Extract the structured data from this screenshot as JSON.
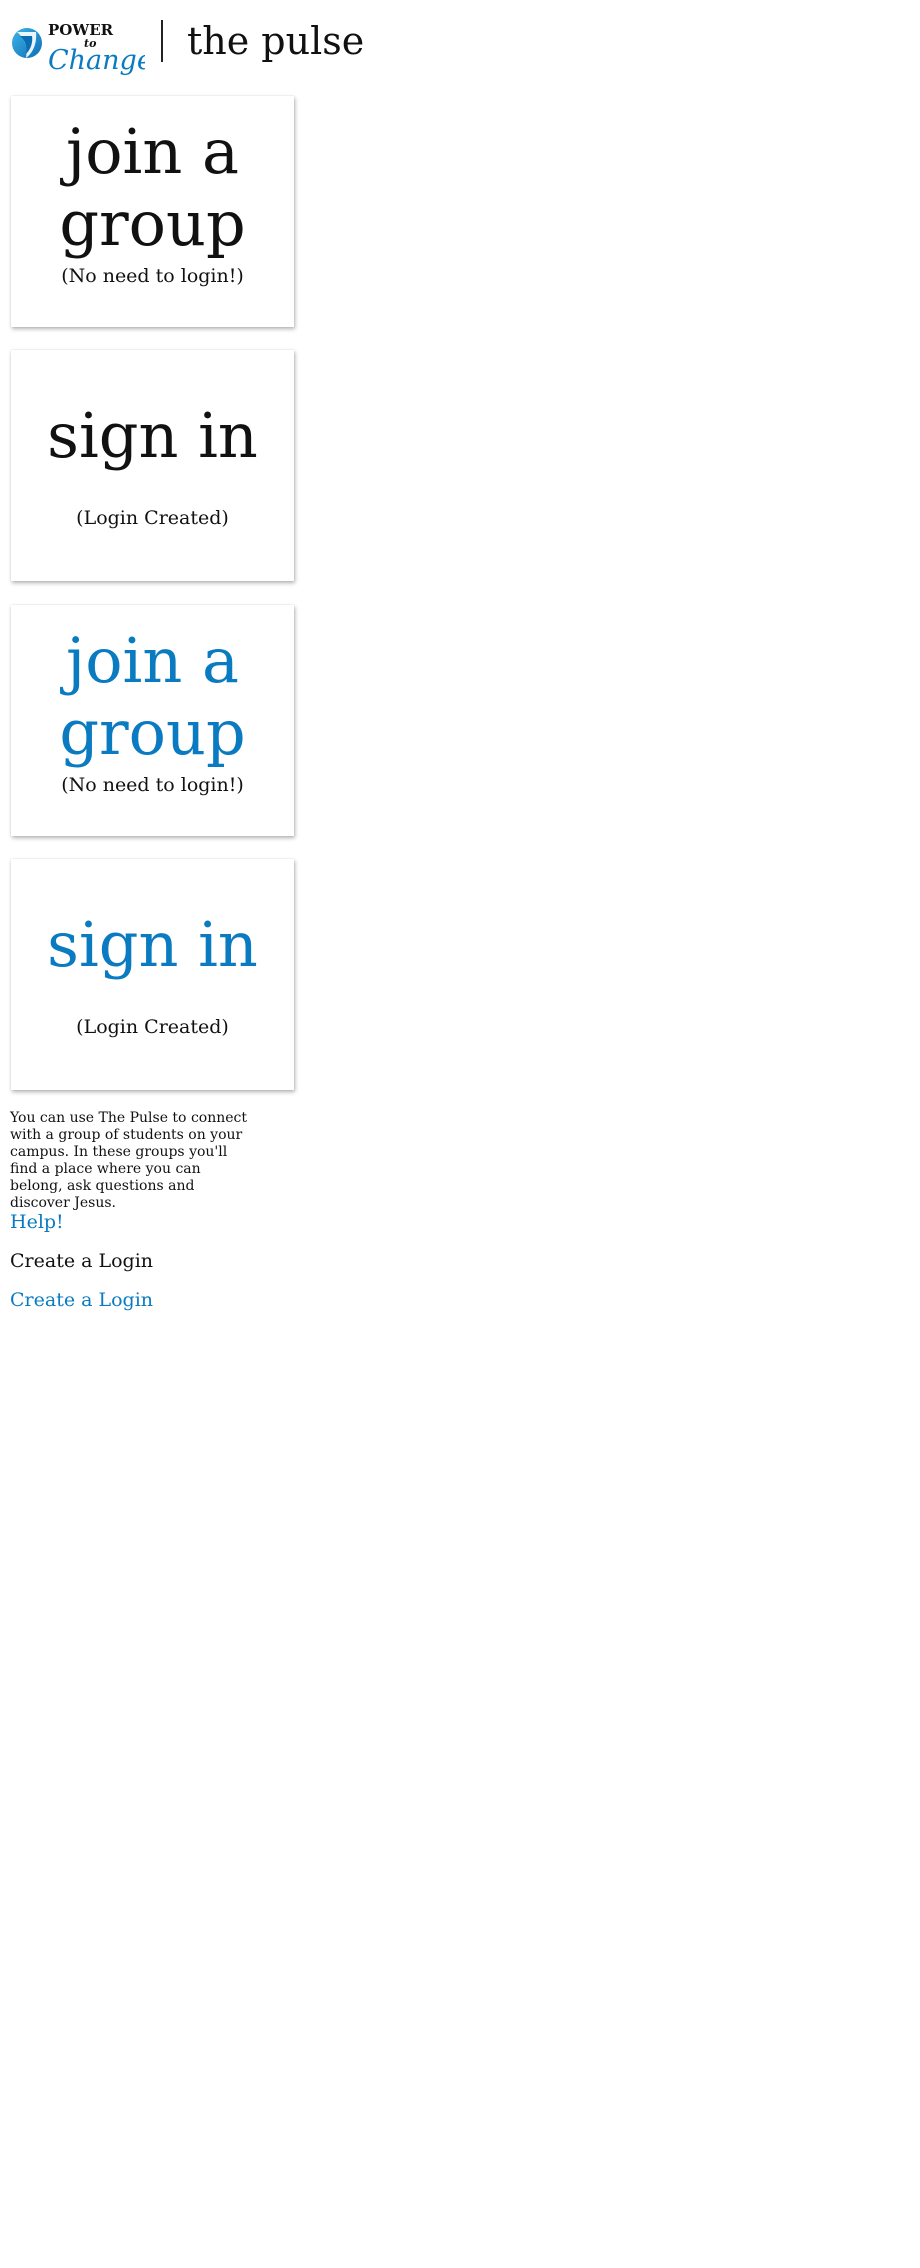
{
  "header": {
    "logo": {
      "line1": "POWER",
      "line2": "to",
      "line3": "Change."
    },
    "title": "the pulse"
  },
  "cards": [
    {
      "main_line1": "join a",
      "main_line2": "group",
      "sub": "(No need to login!)"
    },
    {
      "main": "sign in",
      "sub": "(Login Created)"
    },
    {
      "main_line1": "join a",
      "main_line2": "group",
      "sub": "(No need to login!)"
    },
    {
      "main": "sign in",
      "sub": "(Login Created)"
    }
  ],
  "description": "You can use The Pulse to connect with a group of students on your campus. In these groups you'll find a place where you can belong, ask questions and discover Jesus.",
  "links": {
    "help": "Help!",
    "create_login_1": "Create a Login",
    "create_login_2": "Create a Login"
  },
  "colors": {
    "accent_blue": "#0a7bc1",
    "text_dark": "#111111",
    "background": "#ffffff"
  }
}
